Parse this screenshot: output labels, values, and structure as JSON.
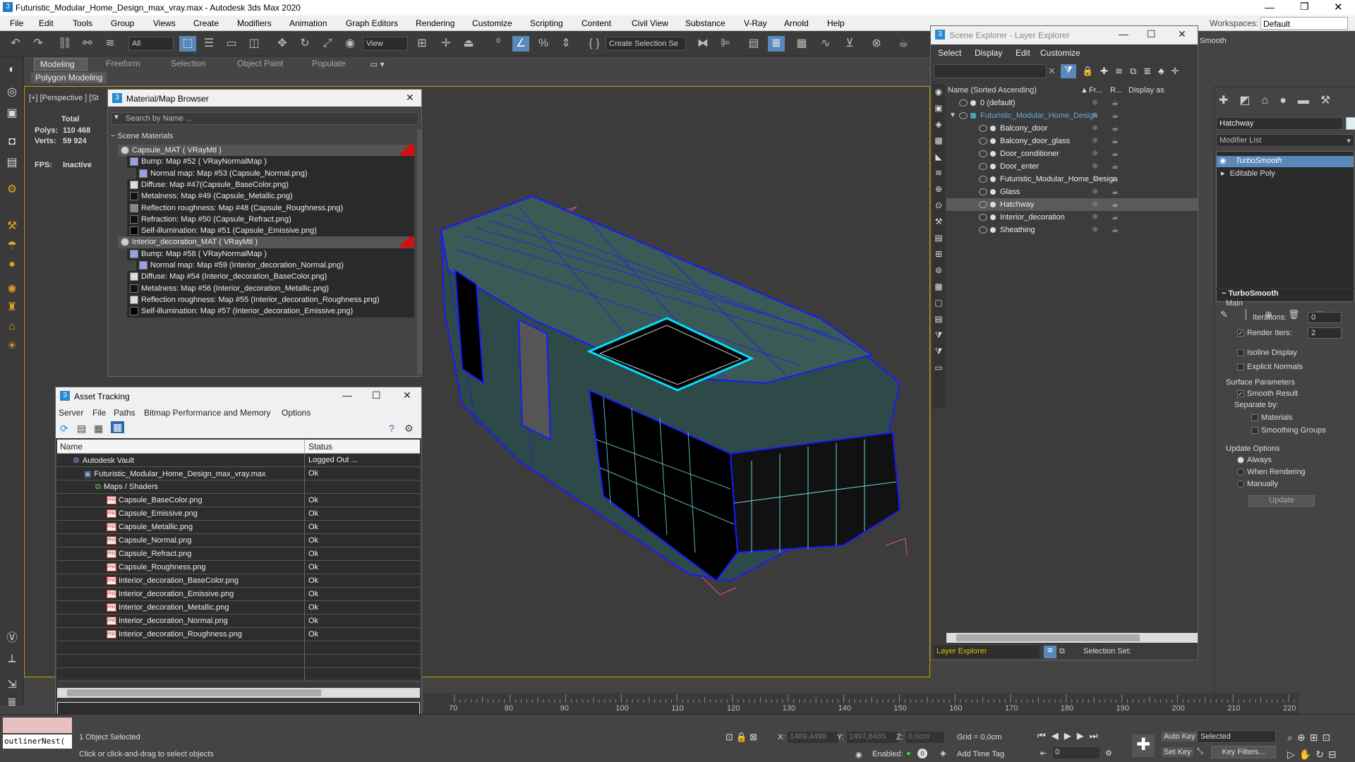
{
  "app": {
    "title": "Futuristic_Modular_Home_Design_max_vray.max - Autodesk 3ds Max 2020",
    "workspace_label": "Workspaces:",
    "workspace_value": "Default"
  },
  "menu": [
    "File",
    "Edit",
    "Tools",
    "Group",
    "Views",
    "Create",
    "Modifiers",
    "Animation",
    "Graph Editors",
    "Rendering",
    "Customize",
    "Scripting",
    "Content",
    "Civil View",
    "Substance",
    "V-Ray",
    "Arnold",
    "Help"
  ],
  "toolbar": {
    "filter": "All",
    "view": "View",
    "selection_set": "Create Selection Se"
  },
  "ribbon": {
    "tabs": [
      "Modeling",
      "Freeform",
      "Selection",
      "Object Paint",
      "Populate"
    ],
    "sub": "Polygon Modeling"
  },
  "viewport": {
    "label": "[+] [Perspective ] [St",
    "stats": {
      "total": "Total",
      "polys_label": "Polys:",
      "polys": "110 468",
      "verts_label": "Verts:",
      "verts": "59 924",
      "fps_label": "FPS:",
      "fps": "Inactive"
    }
  },
  "material_browser": {
    "title": "Material/Map Browser",
    "search": "Search by Name ...",
    "section": "Scene Materials",
    "rows": [
      {
        "t": "Capsule_MAT  ( VRayMtl )",
        "lvl": 0,
        "sw": "mat"
      },
      {
        "t": "Bump: Map #52  ( VRayNormalMap )",
        "lvl": 1,
        "sw": "blue"
      },
      {
        "t": "Normal map: Map #53 (Capsule_Normal.png)",
        "lvl": 2,
        "sw": "blue"
      },
      {
        "t": "Diffuse: Map #47(Capsule_BaseColor.png)",
        "lvl": 1,
        "sw": "mix"
      },
      {
        "t": "Metalness: Map #49 (Capsule_Metallic.png)",
        "lvl": 1,
        "sw": "dark"
      },
      {
        "t": "Reflection roughness: Map #48 (Capsule_Roughness.png)",
        "lvl": 1,
        "sw": "grey"
      },
      {
        "t": "Refraction: Map #50 (Capsule_Refract.png)",
        "lvl": 1,
        "sw": "dark"
      },
      {
        "t": "Self-illumination: Map #51 (Capsule_Emissive.png)",
        "lvl": 1,
        "sw": "black"
      },
      {
        "t": "Interior_decoration_MAT  ( VRayMtl )",
        "lvl": 0,
        "sw": "mat"
      },
      {
        "t": "Bump: Map #58  ( VRayNormalMap )",
        "lvl": 1,
        "sw": "blue"
      },
      {
        "t": "Normal map: Map #59 (Interior_decoration_Normal.png)",
        "lvl": 2,
        "sw": "blue"
      },
      {
        "t": "Diffuse: Map #54 (Interior_decoration_BaseColor.png)",
        "lvl": 1,
        "sw": "mix"
      },
      {
        "t": "Metalness: Map #56 (Interior_decoration_Metallic.png)",
        "lvl": 1,
        "sw": "dark"
      },
      {
        "t": "Reflection roughness: Map #55 (Interior_decoration_Roughness.png)",
        "lvl": 1,
        "sw": "mix"
      },
      {
        "t": "Self-illumination: Map #57 (Interior_decoration_Emissive.png)",
        "lvl": 1,
        "sw": "black"
      }
    ]
  },
  "asset_tracking": {
    "title": "Asset Tracking",
    "menu": [
      "Server",
      "File",
      "Paths",
      "Bitmap Performance and Memory",
      "Options"
    ],
    "col_name": "Name",
    "col_status": "Status",
    "rows": [
      {
        "n": "Autodesk Vault",
        "s": "Logged Out ...",
        "lvl": 0,
        "ic": "vault"
      },
      {
        "n": "Futuristic_Modular_Home_Design_max_vray.max",
        "s": "Ok",
        "lvl": 1,
        "ic": "max"
      },
      {
        "n": "Maps / Shaders",
        "s": "",
        "lvl": 2,
        "ic": "maps"
      },
      {
        "n": "Capsule_BaseColor.png",
        "s": "Ok",
        "lvl": 3,
        "ic": "png"
      },
      {
        "n": "Capsule_Emissive.png",
        "s": "Ok",
        "lvl": 3,
        "ic": "png"
      },
      {
        "n": "Capsule_Metallic.png",
        "s": "Ok",
        "lvl": 3,
        "ic": "png"
      },
      {
        "n": "Capsule_Normal.png",
        "s": "Ok",
        "lvl": 3,
        "ic": "png"
      },
      {
        "n": "Capsule_Refract.png",
        "s": "Ok",
        "lvl": 3,
        "ic": "png"
      },
      {
        "n": "Capsule_Roughness.png",
        "s": "Ok",
        "lvl": 3,
        "ic": "png"
      },
      {
        "n": "Interior_decoration_BaseColor.png",
        "s": "Ok",
        "lvl": 3,
        "ic": "png"
      },
      {
        "n": "Interior_decoration_Emissive.png",
        "s": "Ok",
        "lvl": 3,
        "ic": "png"
      },
      {
        "n": "Interior_decoration_Metallic.png",
        "s": "Ok",
        "lvl": 3,
        "ic": "png"
      },
      {
        "n": "Interior_decoration_Normal.png",
        "s": "Ok",
        "lvl": 3,
        "ic": "png"
      },
      {
        "n": "Interior_decoration_Roughness.png",
        "s": "Ok",
        "lvl": 3,
        "ic": "png"
      }
    ]
  },
  "scene_explorer": {
    "title": "Scene Explorer - Layer Explorer",
    "menu": [
      "Select",
      "Display",
      "Edit",
      "Customize"
    ],
    "col_name": "Name (Sorted Ascending)",
    "col_fr": "Fr...",
    "col_r": "R...",
    "col_disp": "Display as",
    "rows": [
      {
        "n": "0 (default)",
        "lvl": 0,
        "sel": false
      },
      {
        "n": "Futuristic_Modular_Home_Design",
        "lvl": 0,
        "sel": false,
        "expanded": true
      },
      {
        "n": "Balcony_door",
        "lvl": 1,
        "sel": false
      },
      {
        "n": "Balcony_door_glass",
        "lvl": 1,
        "sel": false
      },
      {
        "n": "Door_conditioner",
        "lvl": 1,
        "sel": false
      },
      {
        "n": "Door_enter",
        "lvl": 1,
        "sel": false
      },
      {
        "n": "Futuristic_Modular_Home_Design",
        "lvl": 1,
        "sel": false
      },
      {
        "n": "Glass",
        "lvl": 1,
        "sel": false
      },
      {
        "n": "Hatchway",
        "lvl": 1,
        "sel": true
      },
      {
        "n": "Interior_decoration",
        "lvl": 1,
        "sel": false
      },
      {
        "n": "Sheathing",
        "lvl": 1,
        "sel": false
      }
    ],
    "footer": "Layer Explorer",
    "selection_set": "Selection Set:"
  },
  "command_panel": {
    "object_name": "Hatchway",
    "modifier_list": "Modifier List",
    "stack": [
      "TurboSmooth",
      "Editable Poly"
    ],
    "rollout": "TurboSmooth",
    "main": "Main",
    "iterations_label": "Iterations:",
    "iterations": "0",
    "render_iters_label": "Render Iters:",
    "render_iters": "2",
    "isoline": "Isoline Display",
    "explicit": "Explicit Normals",
    "surface": "Surface Parameters",
    "smooth_result": "Smooth Result",
    "separate": "Separate by:",
    "materials": "Materials",
    "smoothing": "Smoothing Groups",
    "update_opts": "Update Options",
    "always": "Always",
    "when_rendering": "When Rendering",
    "manually": "Manually",
    "update_btn": "Update"
  },
  "timeline": {
    "ticks": [
      "70",
      "80",
      "90",
      "100",
      "110",
      "120",
      "130",
      "140",
      "150",
      "160",
      "170",
      "180",
      "190",
      "200",
      "210",
      "220"
    ]
  },
  "status": {
    "script": "outlinerNest(",
    "objects": "1 Object Selected",
    "hint": "Click or click-and-drag to select objects",
    "x_label": "X:",
    "x": "1489,4496",
    "y_label": "Y:",
    "y": "1497,6465",
    "z_label": "Z:",
    "z": "0,0cm",
    "grid": "Grid = 0,0cm",
    "enabled": "Enabled:",
    "add_time_tag": "Add Time Tag",
    "auto_key": "Auto Key",
    "set_key": "Set Key",
    "selected": "Selected",
    "key_filters": "Key Filters...",
    "frame": "0",
    "smooth_cut": "Smooth"
  },
  "colors": {
    "accent": "#5a88b8",
    "wire": "#1a1aff",
    "select": "#00e0ff",
    "viewport_border": "#c8a000"
  }
}
